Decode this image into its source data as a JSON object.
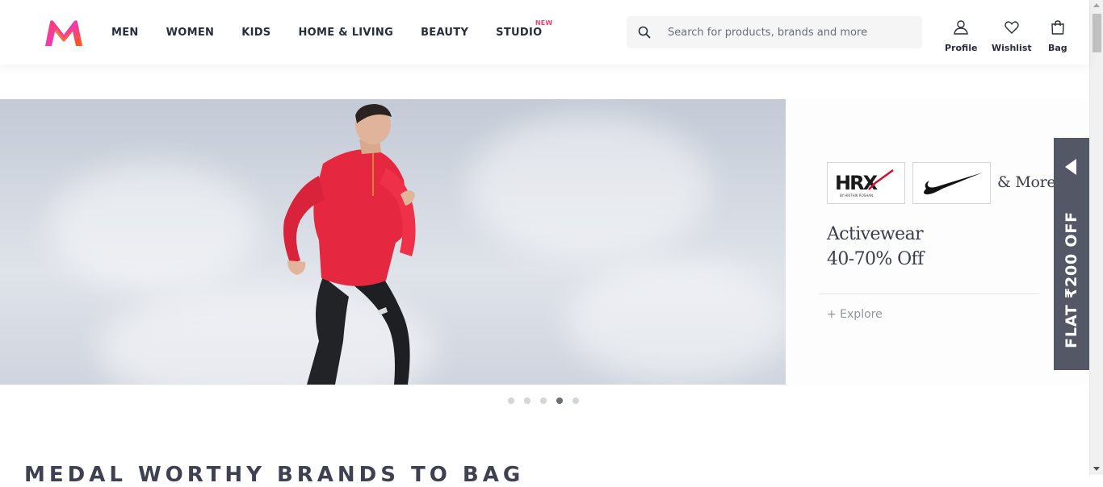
{
  "header": {
    "logo_alt": "Myntra",
    "nav": [
      {
        "label": "MEN"
      },
      {
        "label": "WOMEN"
      },
      {
        "label": "KIDS"
      },
      {
        "label": "HOME & LIVING"
      },
      {
        "label": "BEAUTY"
      },
      {
        "label": "STUDIO",
        "badge": "NEW"
      }
    ],
    "search": {
      "placeholder": "Search for products, brands and more",
      "icon": "search-icon"
    },
    "actions": [
      {
        "label": "Profile",
        "icon": "profile-icon"
      },
      {
        "label": "Wishlist",
        "icon": "heart-icon"
      },
      {
        "label": "Bag",
        "icon": "bag-icon"
      }
    ]
  },
  "banner": {
    "brands": [
      "HRX",
      "Nike"
    ],
    "brand_tagline": "BY HRITHIK ROSHAN",
    "and_more": "& More",
    "headline_line1": "Activewear",
    "headline_line2": "40-70% Off",
    "cta": "+ Explore",
    "dots": 5,
    "active_dot": 4
  },
  "offer_tab": {
    "text": "FLAT ₹200 OFF"
  },
  "section": {
    "title": "MEDAL WORTHY BRANDS TO BAG"
  },
  "colors": {
    "accent": "#ff3f6c",
    "text_primary": "#282c3f",
    "offer_bg": "#535766"
  }
}
